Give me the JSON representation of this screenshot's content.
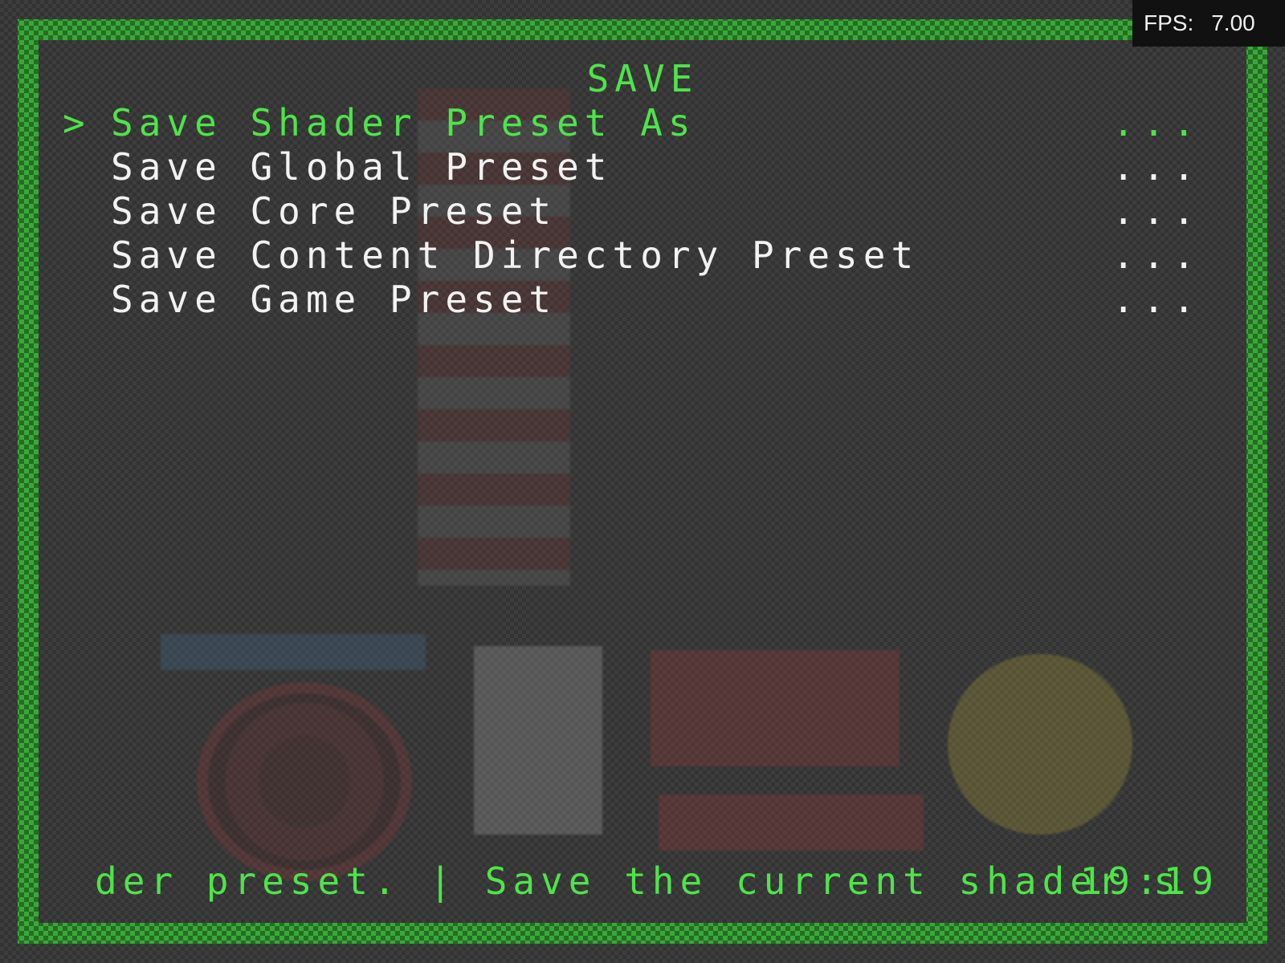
{
  "menu": {
    "title": "SAVE",
    "cursor": ">",
    "items": [
      {
        "label": "Save Shader Preset As",
        "value": "...",
        "selected": true
      },
      {
        "label": "Save Global Preset",
        "value": "..."
      },
      {
        "label": "Save Core Preset",
        "value": "..."
      },
      {
        "label": "Save Content Directory Preset",
        "value": "..."
      },
      {
        "label": "Save Game Preset",
        "value": "..."
      }
    ]
  },
  "footer": {
    "sublabel": "der preset. | Save the current shader s",
    "clock": "19:19"
  },
  "fps": {
    "label": "FPS:",
    "value": "7.00"
  },
  "colors": {
    "accent": "#4ee44a",
    "frame": "#3aa838",
    "text": "#f2f2f2"
  }
}
